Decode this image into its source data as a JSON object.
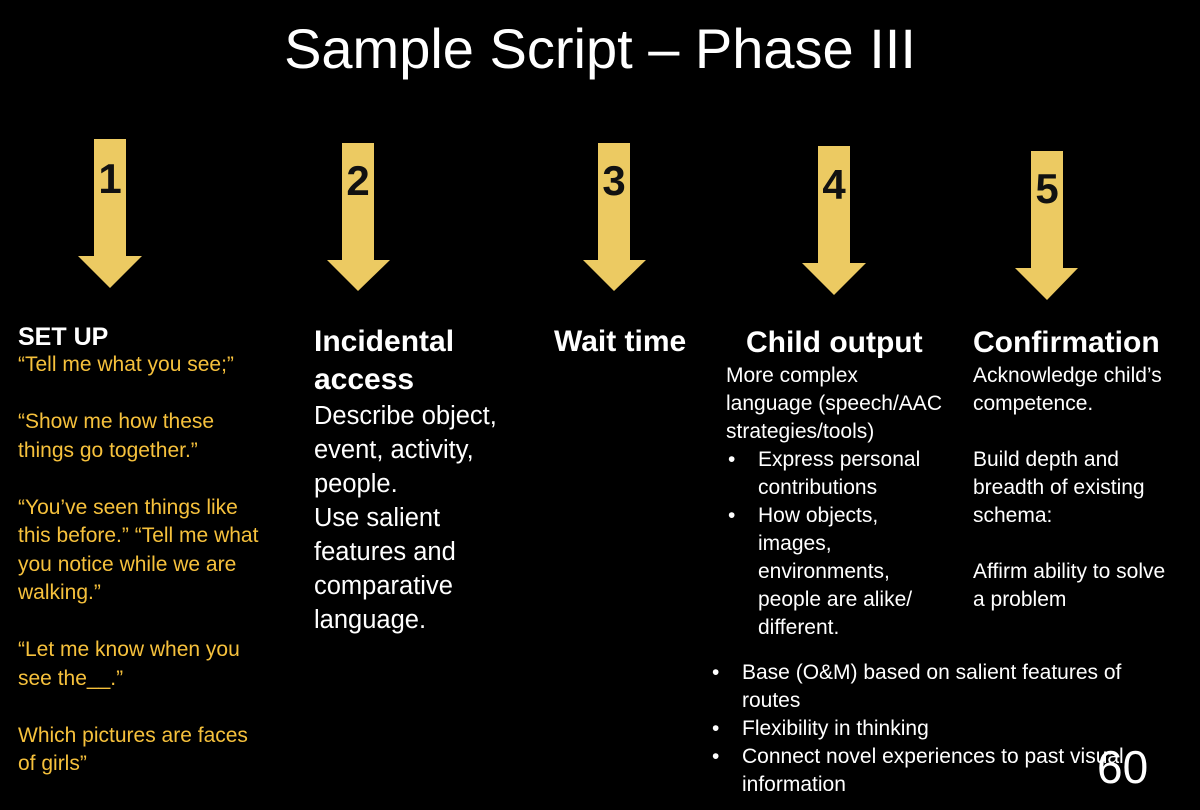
{
  "slide": {
    "title": "Sample Script – Phase III",
    "page_number": "60",
    "colors": {
      "background": "#000000",
      "arrow_fill": "#ecca62",
      "prompt_text": "#f6c13c",
      "text": "#ffffff"
    }
  },
  "steps": [
    {
      "number": "1",
      "heading": "SET UP"
    },
    {
      "number": "2",
      "heading_lines": [
        "Incidental",
        "access"
      ]
    },
    {
      "number": "3",
      "heading": "Wait time"
    },
    {
      "number": "4",
      "heading": "Child output"
    },
    {
      "number": "5",
      "heading": "Confirmation"
    }
  ],
  "setup": {
    "prompts": [
      [
        "“Tell me what you see;”"
      ],
      [
        "“Show me how these",
        "things go together.”"
      ],
      [
        "“You’ve seen things like",
        "this before.” “Tell me what",
        "you notice while we are",
        "walking.”"
      ],
      [
        "“Let me know when you",
        "see the__.”"
      ],
      [
        "Which pictures are faces",
        "of girls”"
      ]
    ]
  },
  "incidental": {
    "lines": [
      "Describe object,",
      "event, activity,",
      "people.",
      "Use salient",
      "features and",
      "comparative",
      "language."
    ]
  },
  "child_output": {
    "intro_lines": [
      "More complex",
      "language (speech/AAC",
      "strategies/tools)"
    ],
    "bullets": [
      [
        "Express personal",
        "contributions"
      ],
      [
        "How objects,",
        "images,",
        "environments,",
        "people are alike/",
        "different."
      ]
    ]
  },
  "confirmation": {
    "paragraphs": [
      [
        "Acknowledge child’s",
        "competence."
      ],
      [
        "Build depth and",
        "breadth of existing",
        "schema:"
      ],
      [
        "Affirm ability to solve",
        "a problem"
      ]
    ]
  },
  "bottom_bullets": [
    [
      "Base (O&M) based on salient features of",
      "routes"
    ],
    [
      "Flexibility in thinking"
    ],
    [
      "Connect novel experiences to past visual",
      "information"
    ]
  ]
}
